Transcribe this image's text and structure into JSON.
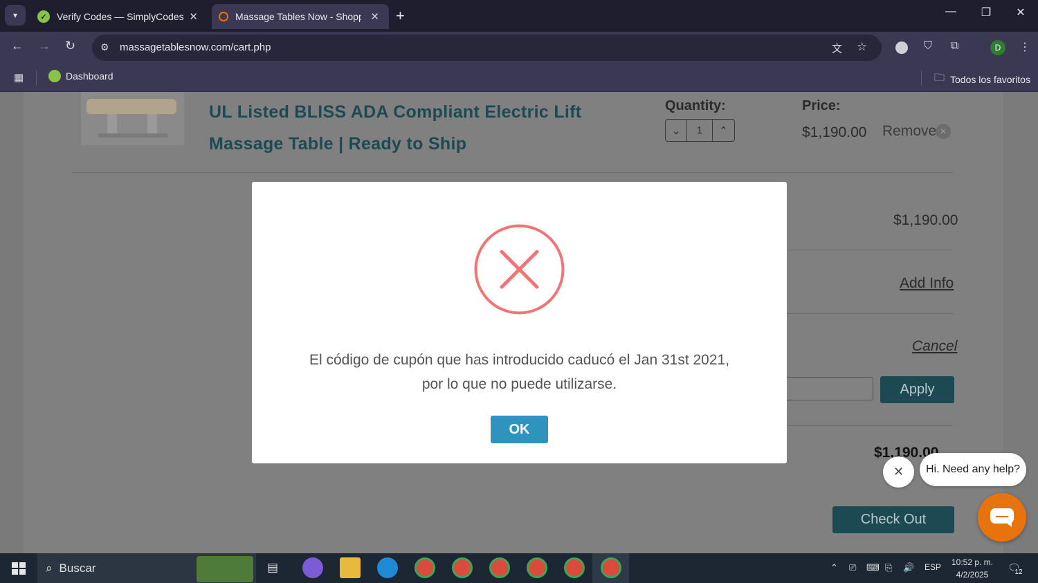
{
  "browser": {
    "tabs": [
      {
        "title": "Verify Codes — SimplyCodes",
        "active": false
      },
      {
        "title": "Massage Tables Now - Shoppin",
        "active": true
      }
    ],
    "url": "massagetablesnow.com/cart.php",
    "profile_initial": "D",
    "bookmarks": {
      "dashboard": "Dashboard",
      "all_favorites": "Todos los favoritos"
    }
  },
  "cart": {
    "product_title": "UL Listed BLISS ADA Compliant Electric Lift Massage Table | Ready to Ship",
    "quantity_label": "Quantity:",
    "quantity_value": "1",
    "price_label": "Price:",
    "price_value": "$1,190.00",
    "remove_label": "Remove",
    "subtotal": "$1,190.00",
    "add_info": "Add Info",
    "cancel": "Cancel",
    "apply": "Apply",
    "total": "$1,190.00",
    "checkout": "Check Out"
  },
  "modal": {
    "message_line1": "El código de cupón que has introducido caducó el Jan 31st 2021,",
    "message_line2": "por lo que no puede utilizarse.",
    "ok_label": "OK",
    "error_color": "#f27474"
  },
  "chat": {
    "bubble_text": "Hi. Need any help?",
    "accent": "#e8720c"
  },
  "taskbar": {
    "search_placeholder": "Buscar",
    "language": "ESP",
    "time": "10:52 p. m.",
    "date": "4/2/2025",
    "notifications": "12"
  },
  "colors": {
    "brand_teal": "#1d4a52",
    "ok_blue": "#2e93bd"
  }
}
